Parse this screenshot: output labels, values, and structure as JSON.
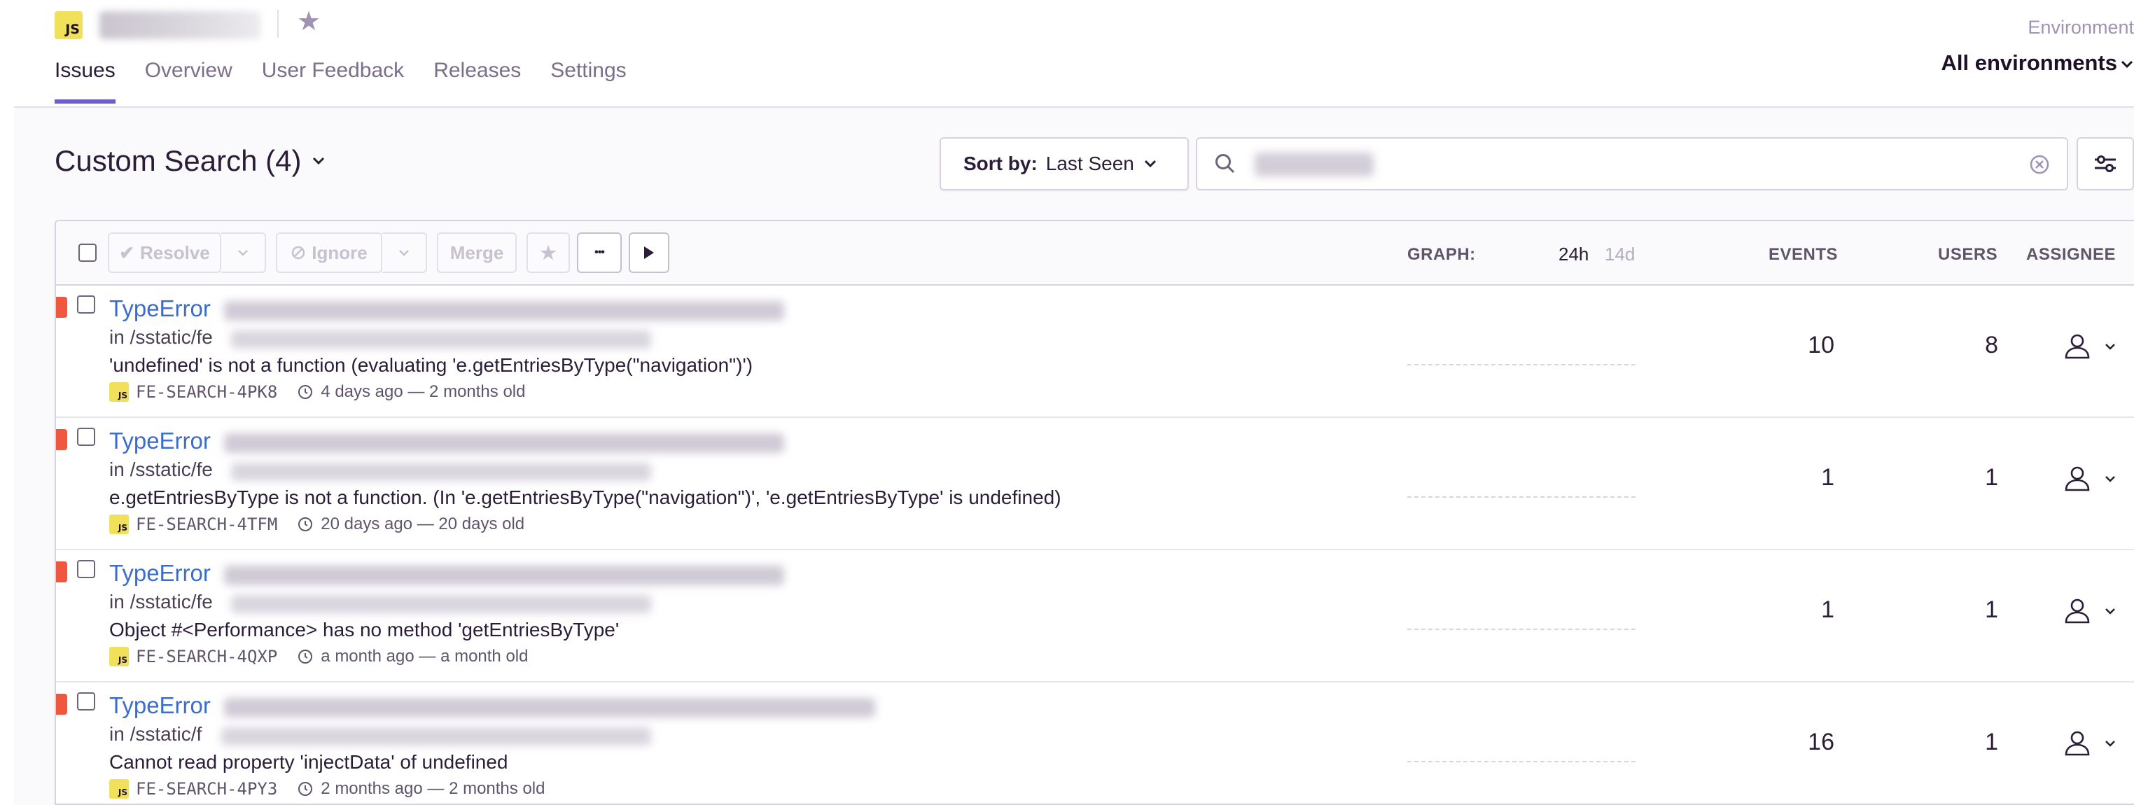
{
  "project": {
    "badge": "JS"
  },
  "tabs": [
    "Issues",
    "Overview",
    "User Feedback",
    "Releases",
    "Settings"
  ],
  "environment": {
    "label": "Environment",
    "value": "All environments"
  },
  "search": {
    "title": "Custom Search (4)",
    "sort_label": "Sort by:",
    "sort_value": "Last Seen"
  },
  "toolbar": {
    "resolve": "Resolve",
    "ignore": "Ignore",
    "merge": "Merge",
    "more": "•••"
  },
  "columns": {
    "graph": "GRAPH:",
    "period_24h": "24h",
    "period_14d": "14d",
    "events": "EVENTS",
    "users": "USERS",
    "assignee": "ASSIGNEE"
  },
  "issues": [
    {
      "type": "TypeError",
      "culprit": "in /sstatic/fe",
      "message": "'undefined' is not a function (evaluating 'e.getEntriesByType(\"navigation\")')",
      "project_badge": "JS",
      "short_id": "FE-SEARCH-4PK8",
      "time": "4 days ago — 2 months old",
      "events": "10",
      "users": "8"
    },
    {
      "type": "TypeError",
      "culprit": "in /sstatic/fe",
      "message": "e.getEntriesByType is not a function. (In 'e.getEntriesByType(\"navigation\")', 'e.getEntriesByType' is undefined)",
      "project_badge": "JS",
      "short_id": "FE-SEARCH-4TFM",
      "time": "20 days ago — 20 days old",
      "events": "1",
      "users": "1"
    },
    {
      "type": "TypeError",
      "culprit": "in /sstatic/fe",
      "message": "Object #<Performance> has no method 'getEntriesByType'",
      "project_badge": "JS",
      "short_id": "FE-SEARCH-4QXP",
      "time": "a month ago — a month old",
      "events": "1",
      "users": "1"
    },
    {
      "type": "TypeError",
      "culprit": "in /sstatic/f",
      "message": "Cannot read property 'injectData' of undefined",
      "project_badge": "JS",
      "short_id": "FE-SEARCH-4PY3",
      "time": "2 months ago — 2 months old",
      "events": "16",
      "users": "1"
    }
  ],
  "colors": {
    "accent": "#6c5fc7",
    "link": "#3b6ecc",
    "error_level": "#f1573f",
    "js_badge": "#f1e05a"
  }
}
